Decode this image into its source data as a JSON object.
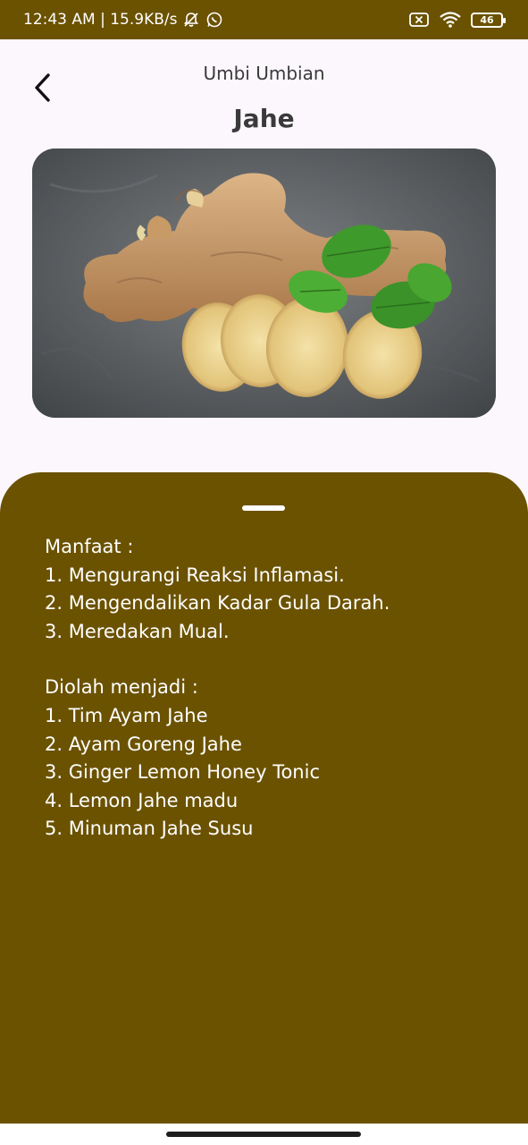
{
  "status_bar": {
    "time_text": "12:43 AM | 15.9KB/s",
    "battery_level": "46",
    "icons": [
      "bell-off-icon",
      "whatsapp-icon",
      "sim-off-icon",
      "wifi-icon",
      "battery-icon"
    ]
  },
  "header": {
    "category": "Umbi Umbian",
    "title": "Jahe",
    "back_icon": "chevron-left-icon"
  },
  "hero": {
    "image_subject": "ginger root with slices and mint leaves"
  },
  "sheet": {
    "benefits_heading": "Manfaat :",
    "benefits": [
      "1. Mengurangi Reaksi Inflamasi.",
      "2. Mengendalikan Kadar Gula Darah.",
      "3. Meredakan Mual."
    ],
    "processed_heading": "Diolah menjadi :",
    "processed": [
      "1. Tim Ayam Jahe",
      "2. Ayam Goreng Jahe",
      "3. Ginger Lemon Honey Tonic",
      "4. Lemon Jahe madu",
      "5. Minuman Jahe Susu"
    ]
  },
  "colors": {
    "brand": "#6b5200",
    "page_background": "#fbf7fd",
    "text_dark": "#3a3a3a",
    "sheet_text": "#ffffff"
  }
}
